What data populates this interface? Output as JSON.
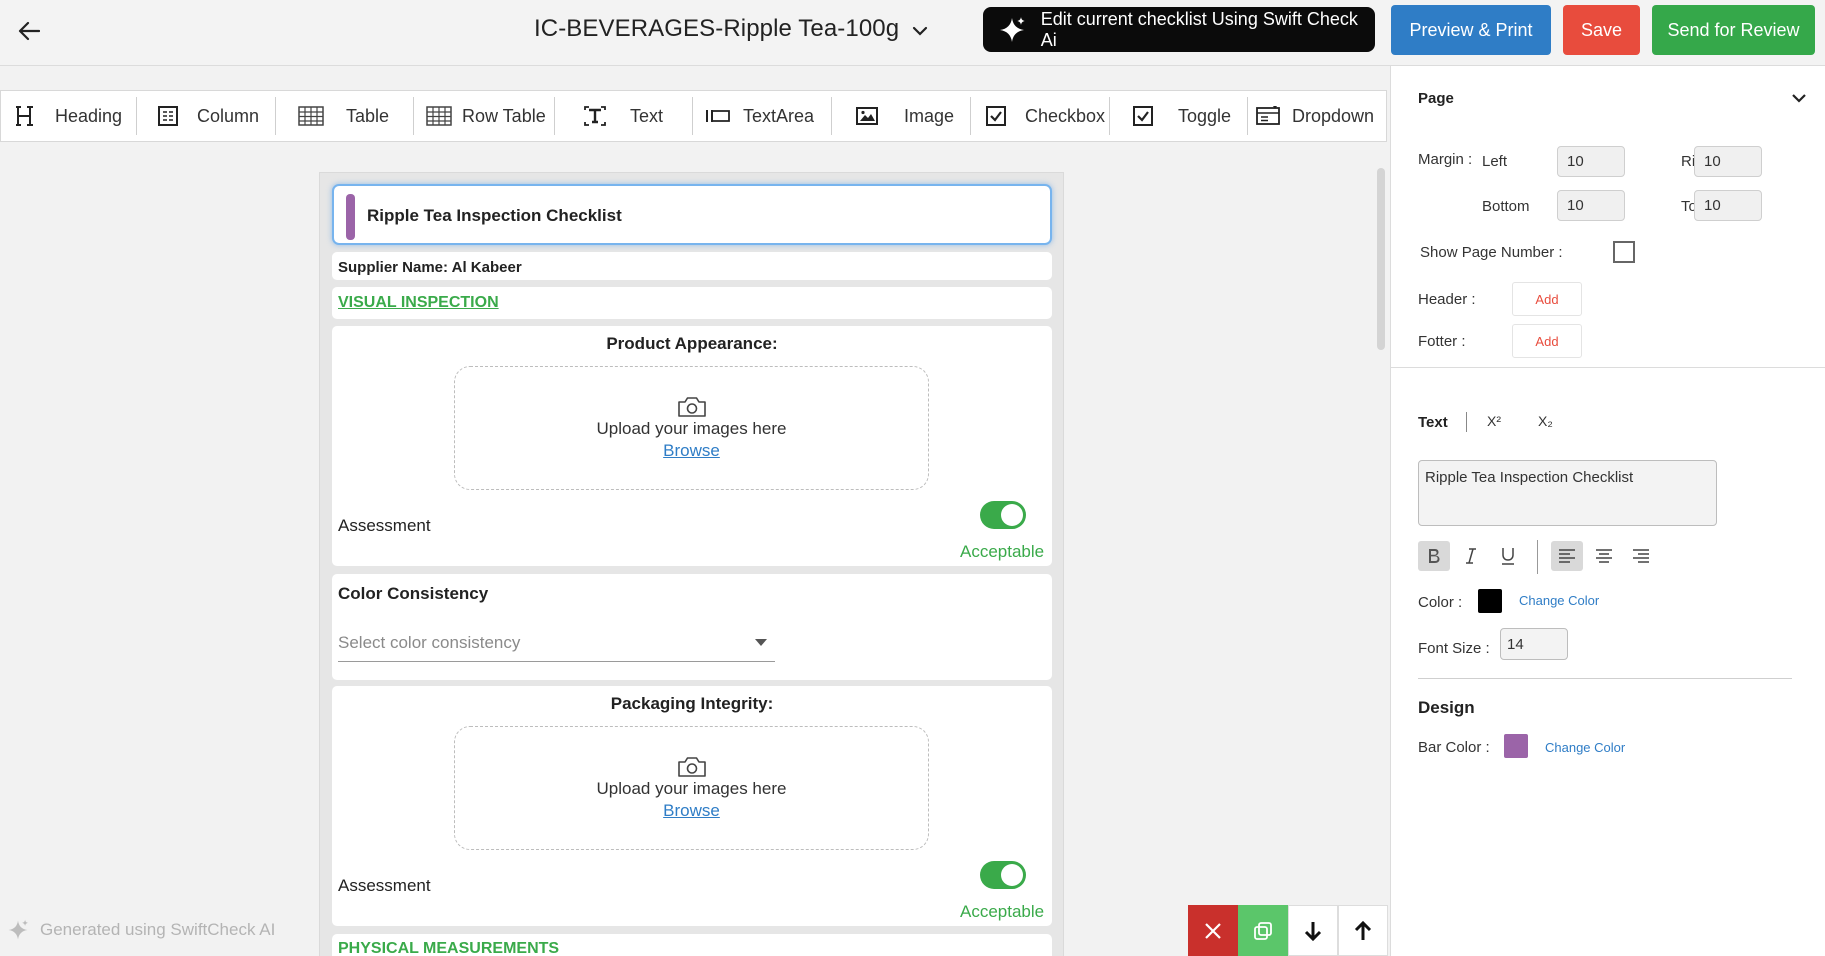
{
  "header": {
    "title": "IC-BEVERAGES-Ripple Tea-100g",
    "ai_button": "Edit current checklist Using Swift Check Ai",
    "preview_button": "Preview & Print",
    "save_button": "Save",
    "review_button": "Send for Review"
  },
  "toolbar": {
    "items": [
      {
        "label": "Heading",
        "icon": "heading-icon"
      },
      {
        "label": "Column",
        "icon": "column-icon"
      },
      {
        "label": "Table",
        "icon": "table-icon"
      },
      {
        "label": "Row Table",
        "icon": "row-table-icon"
      },
      {
        "label": "Text",
        "icon": "text-icon"
      },
      {
        "label": "TextArea",
        "icon": "textarea-icon"
      },
      {
        "label": "Image",
        "icon": "image-icon"
      },
      {
        "label": "Checkbox",
        "icon": "checkbox-icon"
      },
      {
        "label": "Toggle",
        "icon": "toggle-icon"
      },
      {
        "label": "Dropdown",
        "icon": "dropdown-icon"
      }
    ]
  },
  "checklist": {
    "heading": "Ripple Tea Inspection Checklist",
    "supplier": "Supplier Name: Al Kabeer",
    "section_visual": "VISUAL INSPECTION",
    "product_appearance": {
      "label": "Product Appearance:",
      "upload_text": "Upload your images here",
      "browse": "Browse",
      "assessment": "Assessment",
      "toggle_label": "Acceptable",
      "toggle_on": true
    },
    "color_consistency": {
      "label": "Color Consistency",
      "placeholder": "Select color consistency"
    },
    "packaging_integrity": {
      "label": "Packaging Integrity:",
      "upload_text": "Upload your images here",
      "browse": "Browse",
      "assessment": "Assessment",
      "toggle_label": "Acceptable",
      "toggle_on": true
    },
    "section_physical": "PHYSICAL MEASUREMENTS"
  },
  "footer_note": "Generated using SwiftCheck AI",
  "panel": {
    "page": {
      "title": "Page",
      "margin_label": "Margin :",
      "left_label": "Left",
      "left_value": "10",
      "right_label": "Right",
      "right_value": "10",
      "bottom_label": "Bottom",
      "bottom_value": "10",
      "top_label": "Top",
      "top_value": "10",
      "show_page_number_label": "Show Page Number :",
      "show_page_number": false,
      "header_label": "Header :",
      "header_add": "Add",
      "footer_label": "Fotter :",
      "footer_add": "Add"
    },
    "text": {
      "tab_text": "Text",
      "tab_superscript": "X²",
      "tab_subscript": "X₂",
      "value": "Ripple Tea Inspection Checklist",
      "color_label": "Color :",
      "color_value": "#000000",
      "change_color": "Change Color",
      "font_size_label": "Font Size :",
      "font_size_value": "14",
      "bold_active": true,
      "align": "left"
    },
    "design": {
      "title": "Design",
      "bar_color_label": "Bar Color :",
      "bar_color_value": "#9b64a8",
      "change_color": "Change Color"
    }
  },
  "colors": {
    "primary_blue": "#2f7dc6",
    "save_red": "#e84c3d",
    "review_green": "#35a84a",
    "accent_green": "#3aaa4a",
    "bar_purple": "#9b64a8"
  }
}
